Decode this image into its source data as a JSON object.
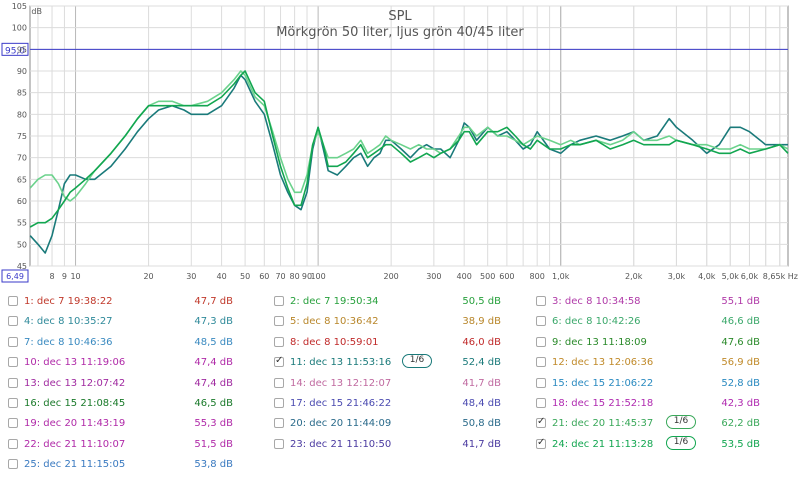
{
  "chart_data": {
    "type": "line",
    "title": "SPL",
    "subtitle": "Mörkgrön 50 liter, ljus grön 40/45 liter",
    "ylabel": "dB",
    "xunit": "Hz",
    "xlim": [
      6.49,
      8650
    ],
    "ylim": [
      45,
      105
    ],
    "xscale": "log",
    "grid": true,
    "y_ticks": [
      "45",
      "50",
      "55",
      "60",
      "65",
      "70",
      "75",
      "80",
      "85",
      "90",
      "95",
      "100",
      "105"
    ],
    "x_ticks": [
      "8",
      "9",
      "10",
      "20",
      "30",
      "40",
      "50",
      "60",
      "70",
      "80",
      "90",
      "100",
      "200",
      "300",
      "400",
      "500",
      "600",
      "800",
      "1,0k",
      "2,0k",
      "3,0k",
      "4,0k",
      "5,0k",
      "6,0k",
      "8,65k Hz"
    ],
    "x_range_start_label": "6,49",
    "reference_line_label": "95,0",
    "reference_line_value": 95,
    "series": [
      {
        "name": "11: dec 13 11:53:16",
        "color": "#1a7a7a",
        "x": [
          6.5,
          7.0,
          7.5,
          8.0,
          8.5,
          9.0,
          9.5,
          10,
          11,
          12,
          14,
          16,
          18,
          20,
          22,
          25,
          28,
          30,
          35,
          40,
          45,
          48,
          50,
          55,
          60,
          65,
          70,
          75,
          80,
          85,
          90,
          95,
          100,
          105,
          110,
          120,
          130,
          140,
          150,
          160,
          170,
          180,
          190,
          200,
          220,
          240,
          260,
          280,
          300,
          320,
          350,
          380,
          400,
          420,
          450,
          500,
          550,
          600,
          650,
          700,
          750,
          800,
          900,
          1000,
          1100,
          1200,
          1400,
          1600,
          1800,
          2000,
          2200,
          2500,
          2800,
          3000,
          3500,
          4000,
          4500,
          5000,
          5500,
          6000,
          7000,
          8000,
          8650
        ],
        "y": [
          52,
          50,
          48,
          52,
          58,
          64,
          66,
          66,
          65,
          65,
          68,
          72,
          76,
          79,
          81,
          82,
          81,
          80,
          80,
          82,
          86,
          89,
          88,
          83,
          80,
          73,
          66,
          62,
          59,
          58,
          62,
          72,
          77,
          72,
          67,
          66,
          68,
          70,
          71,
          68,
          70,
          71,
          74,
          74,
          72,
          70,
          72,
          73,
          72,
          72,
          70,
          74,
          78,
          77,
          74,
          77,
          75,
          76,
          74,
          72,
          73,
          76,
          72,
          71,
          73,
          74,
          75,
          74,
          75,
          76,
          74,
          75,
          79,
          77,
          74,
          71,
          73,
          77,
          77,
          76,
          73,
          73,
          73
        ]
      },
      {
        "name": "21: dec 20 11:45:37",
        "color": "#6bd28c",
        "x": [
          6.5,
          7.0,
          7.5,
          8.0,
          8.5,
          9.0,
          9.5,
          10,
          11,
          12,
          14,
          16,
          18,
          20,
          22,
          25,
          28,
          30,
          35,
          40,
          45,
          48,
          50,
          55,
          60,
          65,
          70,
          75,
          80,
          85,
          90,
          95,
          100,
          105,
          110,
          120,
          130,
          140,
          150,
          160,
          170,
          180,
          190,
          200,
          220,
          240,
          260,
          280,
          300,
          320,
          350,
          380,
          400,
          420,
          450,
          500,
          550,
          600,
          650,
          700,
          750,
          800,
          900,
          1000,
          1100,
          1200,
          1400,
          1600,
          1800,
          2000,
          2200,
          2500,
          2800,
          3000,
          3500,
          4000,
          4500,
          5000,
          5500,
          6000,
          7000,
          8000,
          8650
        ],
        "y": [
          63,
          65,
          66,
          66,
          64,
          61,
          60,
          61,
          64,
          67,
          71,
          75,
          79,
          82,
          83,
          83,
          82,
          82,
          83,
          85,
          88,
          90,
          89,
          84,
          82,
          76,
          70,
          65,
          62,
          62,
          66,
          73,
          76,
          73,
          70,
          70,
          71,
          72,
          74,
          71,
          72,
          73,
          75,
          74,
          73,
          72,
          73,
          72,
          72,
          71,
          72,
          75,
          77,
          77,
          75,
          77,
          75,
          75,
          74,
          73,
          74,
          75,
          74,
          73,
          74,
          73,
          74,
          73,
          74,
          76,
          74,
          74,
          75,
          74,
          73,
          73,
          72,
          72,
          73,
          72,
          72,
          73,
          72
        ]
      },
      {
        "name": "24: dec 21 11:13:28",
        "color": "#12a650",
        "x": [
          6.5,
          7.0,
          7.5,
          8.0,
          8.5,
          9.0,
          9.5,
          10,
          11,
          12,
          14,
          16,
          18,
          20,
          22,
          25,
          28,
          30,
          35,
          40,
          45,
          48,
          50,
          55,
          60,
          65,
          70,
          75,
          80,
          85,
          90,
          95,
          100,
          105,
          110,
          120,
          130,
          140,
          150,
          160,
          170,
          180,
          190,
          200,
          220,
          240,
          260,
          280,
          300,
          320,
          350,
          380,
          400,
          420,
          450,
          500,
          550,
          600,
          650,
          700,
          750,
          800,
          900,
          1000,
          1100,
          1200,
          1400,
          1600,
          1800,
          2000,
          2200,
          2500,
          2800,
          3000,
          3500,
          4000,
          4500,
          5000,
          5500,
          6000,
          7000,
          8000,
          8650
        ],
        "y": [
          54,
          55,
          55,
          56,
          58,
          60,
          62,
          63,
          65,
          67,
          71,
          75,
          79,
          82,
          82,
          82,
          82,
          82,
          82,
          84,
          87,
          89,
          90,
          85,
          83,
          75,
          68,
          63,
          59,
          59,
          64,
          73,
          77,
          73,
          68,
          68,
          69,
          71,
          73,
          70,
          71,
          72,
          73,
          73,
          71,
          69,
          70,
          71,
          70,
          71,
          72,
          74,
          76,
          76,
          73,
          76,
          76,
          77,
          75,
          73,
          72,
          74,
          72,
          72,
          73,
          73,
          74,
          72,
          73,
          74,
          73,
          73,
          73,
          74,
          73,
          72,
          71,
          71,
          72,
          71,
          72,
          73,
          71
        ]
      }
    ]
  },
  "measurements": [
    [
      {
        "label": "1: dec 7 19:38:22",
        "value": "47,7 dB",
        "color": "#c0392b",
        "checked": false
      },
      {
        "label": "2: dec 7 19:50:34",
        "value": "50,5 dB",
        "color": "#27a03c",
        "checked": false
      },
      {
        "label": "3: dec 8 10:34:58",
        "value": "55,1 dB",
        "color": "#b03aa8",
        "checked": false
      }
    ],
    [
      {
        "label": "4: dec 8 10:35:27",
        "value": "47,3 dB",
        "color": "#2f8a9a",
        "checked": false
      },
      {
        "label": "5: dec 8 10:36:42",
        "value": "38,9 dB",
        "color": "#b8862a",
        "checked": false
      },
      {
        "label": "6: dec 8 10:42:26",
        "value": "46,6 dB",
        "color": "#3aa86a",
        "checked": false
      }
    ],
    [
      {
        "label": "7: dec 8 10:46:36",
        "value": "48,5 dB",
        "color": "#3a8ac0",
        "checked": false
      },
      {
        "label": "8: dec 8 10:59:01",
        "value": "46,0 dB",
        "color": "#c02a2a",
        "checked": false
      },
      {
        "label": "9: dec 13 11:18:09",
        "value": "47,6 dB",
        "color": "#2a8a2a",
        "checked": false
      }
    ],
    [
      {
        "label": "10: dec 13 11:19:06",
        "value": "47,4 dB",
        "color": "#b02aa8",
        "checked": false
      },
      {
        "label": "11: dec 13 11:53:16",
        "value": "52,4 dB",
        "color": "#1a7a7a",
        "checked": true,
        "smoothing": "1/6"
      },
      {
        "label": "12: dec 13 12:06:36",
        "value": "56,9 dB",
        "color": "#c08a2a",
        "checked": false
      }
    ],
    [
      {
        "label": "13: dec 13 12:07:42",
        "value": "47,4 dB",
        "color": "#a02aa0",
        "checked": false
      },
      {
        "label": "14: dec 13 12:12:07",
        "value": "41,7 dB",
        "color": "#c06aa0",
        "checked": false
      },
      {
        "label": "15: dec 15 21:06:22",
        "value": "52,8 dB",
        "color": "#2a8ac0",
        "checked": false
      }
    ],
    [
      {
        "label": "16: dec 15 21:08:45",
        "value": "46,5 dB",
        "color": "#1a7a2a",
        "checked": false
      },
      {
        "label": "17: dec 15 21:46:22",
        "value": "48,4 dB",
        "color": "#4a4ab0",
        "checked": false
      },
      {
        "label": "18: dec 15 21:52:18",
        "value": "42,3 dB",
        "color": "#b02ab0",
        "checked": false
      }
    ],
    [
      {
        "label": "19: dec 20 11:43:19",
        "value": "55,3 dB",
        "color": "#b02aa8",
        "checked": false
      },
      {
        "label": "20: dec 20 11:44:09",
        "value": "50,8 dB",
        "color": "#2a6a8a",
        "checked": false
      },
      {
        "label": "21: dec 20 11:45:37",
        "value": "62,2 dB",
        "color": "#3aa85a",
        "checked": true,
        "smoothing": "1/6"
      }
    ],
    [
      {
        "label": "22: dec 21 11:10:07",
        "value": "51,5 dB",
        "color": "#b02aa8",
        "checked": false
      },
      {
        "label": "23: dec 21 11:10:50",
        "value": "41,7 dB",
        "color": "#4a3aa0",
        "checked": false
      },
      {
        "label": "24: dec 21 11:13:28",
        "value": "53,5 dB",
        "color": "#12a650",
        "checked": true,
        "smoothing": "1/6"
      }
    ],
    [
      {
        "label": "25: dec 21 11:15:05",
        "value": "53,8 dB",
        "color": "#3a7ac0",
        "checked": false
      }
    ]
  ]
}
